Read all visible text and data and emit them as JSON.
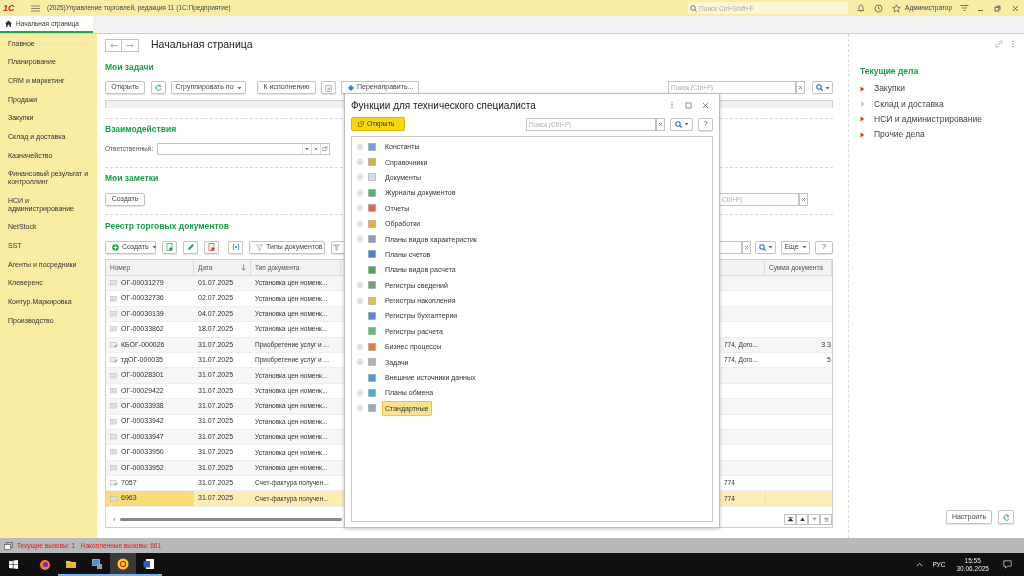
{
  "window": {
    "logo": "1С",
    "title": "(2025)Управление торговлей, редакция 11  (1С:Предприятие)",
    "search_placeholder": "Поиск Ctrl+Shift+F",
    "user": "Администратор"
  },
  "tabs": [
    {
      "label": "Начальная страница",
      "selected": true
    }
  ],
  "sidebar": {
    "items": [
      "Главное",
      "Планирование",
      "CRM и маркетинг",
      "Продажи",
      "Закупки",
      "Склад и доставка",
      "Казначейство",
      "Финансовый результат и контроллинг",
      "НСИ и администрирование",
      "NetStock",
      "SST",
      "Агенты и посредники",
      "Клеверенс",
      "Контур.Маркировка",
      "Производство"
    ]
  },
  "page": {
    "title": "Начальная страница"
  },
  "my_tasks": {
    "title": "Мои задачи",
    "buttons": [
      "Открыть",
      "Сгруппировать по",
      "К исполнению",
      "Перенаправить..."
    ],
    "search_placeholder": "Поиск (Ctrl+F)"
  },
  "interactions": {
    "title": "Взаимодействия",
    "responsible_label": "Ответственный:"
  },
  "my_notes": {
    "title": "Мои заметки",
    "create_button": "Создать",
    "search_placeholder": "Ctrl+F)"
  },
  "registry": {
    "title": "Реестр торговых документов",
    "left_buttons": [
      "Создать",
      "Типы документов"
    ],
    "more_button": "Еще",
    "help_button": "?",
    "columns": [
      {
        "label": "Номер",
        "sorted": false
      },
      {
        "label": "Дата",
        "sorted": true
      },
      {
        "label": "Тип документа",
        "sorted": false
      },
      {
        "label": "Сумма документа",
        "sorted": false
      }
    ],
    "rows": [
      {
        "number": "ОГ-00031279",
        "date": "01.07.2025",
        "type": "Установка цен номенк...",
        "column_4": "",
        "sum": "",
        "posted": false,
        "selected": false
      },
      {
        "number": "ОГ-00032736",
        "date": "02.07.2025",
        "type": "Установка цен номенк...",
        "column_4": "",
        "sum": "",
        "posted": false,
        "selected": false
      },
      {
        "number": "ОГ-00030139",
        "date": "04.07.2025",
        "type": "Установка цен номенк...",
        "column_4": "",
        "sum": "",
        "posted": false,
        "selected": false
      },
      {
        "number": "ОГ-00033862",
        "date": "18.07.2025",
        "type": "Установка цен номенк...",
        "column_4": "",
        "sum": "",
        "posted": false,
        "selected": false
      },
      {
        "number": "КБОГ-000026",
        "date": "31.07.2025",
        "type": "Приобретение услуг и ...",
        "column_4": "774, Дого...",
        "sum": "3 3",
        "posted": true,
        "selected": false
      },
      {
        "number": "тдОГ-000035",
        "date": "31.07.2025",
        "type": "Приобретение услуг и ...",
        "column_4": "774, Дого...",
        "sum": "5",
        "posted": true,
        "selected": false
      },
      {
        "number": "ОГ-00028301",
        "date": "31.07.2025",
        "type": "Установка цен номенк...",
        "column_4": "",
        "sum": "",
        "posted": false,
        "selected": false
      },
      {
        "number": "ОГ-00029422",
        "date": "31.07.2025",
        "type": "Установка цен номенк...",
        "column_4": "",
        "sum": "",
        "posted": false,
        "selected": false
      },
      {
        "number": "ОГ-00033938",
        "date": "31.07.2025",
        "type": "Установка цен номенк...",
        "column_4": "",
        "sum": "",
        "posted": false,
        "selected": false
      },
      {
        "number": "ОГ-00033942",
        "date": "31.07.2025",
        "type": "Установка цен номенк...",
        "column_4": "",
        "sum": "",
        "posted": false,
        "selected": false
      },
      {
        "number": "ОГ-00033947",
        "date": "31.07.2025",
        "type": "Установка цен номенк...",
        "column_4": "",
        "sum": "",
        "posted": false,
        "selected": false
      },
      {
        "number": "ОГ-00033950",
        "date": "31.07.2025",
        "type": "Установка цен номенк...",
        "column_4": "",
        "sum": "",
        "posted": false,
        "selected": false
      },
      {
        "number": "ОГ-00033952",
        "date": "31.07.2025",
        "type": "Установка цен номенк...",
        "column_4": "",
        "sum": "",
        "posted": false,
        "selected": false
      },
      {
        "number": "7057",
        "date": "31.07.2025",
        "type": "Счет-фактура получен...",
        "column_4": "774",
        "sum": "",
        "posted": true,
        "selected": false
      },
      {
        "number": "6963",
        "date": "31.07.2025",
        "type": "Счет-фактура получен...",
        "column_4": "774",
        "sum": "",
        "posted": false,
        "selected": true
      }
    ]
  },
  "current_tasks": {
    "title": "Текущие дела",
    "items": [
      {
        "label": "Закупки",
        "has_alerts": true
      },
      {
        "label": "Склад и доставка",
        "has_alerts": false
      },
      {
        "label": "НСИ и администрирование",
        "has_alerts": true
      },
      {
        "label": "Прочие дела",
        "has_alerts": true
      }
    ],
    "configure_button": "Настроить"
  },
  "dialog": {
    "title": "Функции для технического специалиста",
    "open_button": "Открыть",
    "search_placeholder": "Поиск (Ctrl+F)",
    "help_button": "?",
    "tree": [
      {
        "label": "Константы",
        "expandable": true,
        "selected": false
      },
      {
        "label": "Справочники",
        "expandable": true,
        "selected": false
      },
      {
        "label": "Документы",
        "expandable": true,
        "selected": false
      },
      {
        "label": "Журналы документов",
        "expandable": true,
        "selected": false
      },
      {
        "label": "Отчеты",
        "expandable": true,
        "selected": false
      },
      {
        "label": "Обработки",
        "expandable": true,
        "selected": false
      },
      {
        "label": "Планы видов характеристик",
        "expandable": true,
        "selected": false
      },
      {
        "label": "Планы счетов",
        "expandable": false,
        "selected": false
      },
      {
        "label": "Планы видов расчета",
        "expandable": false,
        "selected": false
      },
      {
        "label": "Регистры сведений",
        "expandable": true,
        "selected": false
      },
      {
        "label": "Регистры накопления",
        "expandable": true,
        "selected": false
      },
      {
        "label": "Регистры бухгалтерии",
        "expandable": false,
        "selected": false
      },
      {
        "label": "Регистры расчета",
        "expandable": false,
        "selected": false
      },
      {
        "label": "Бизнес процессы",
        "expandable": true,
        "selected": false
      },
      {
        "label": "Задачи",
        "expandable": true,
        "selected": false
      },
      {
        "label": "Внешние источники данных",
        "expandable": false,
        "selected": false
      },
      {
        "label": "Планы обмена",
        "expandable": true,
        "selected": false
      },
      {
        "label": "Стандартные",
        "expandable": true,
        "selected": true
      }
    ]
  },
  "status_bar": {
    "current_calls": "Текущие вызовы: 1",
    "accumulated_calls": "Накопленные вызовы: 661"
  },
  "taskbar": {
    "language": "РУС",
    "time": "15:55",
    "date": "30.06.2025"
  }
}
